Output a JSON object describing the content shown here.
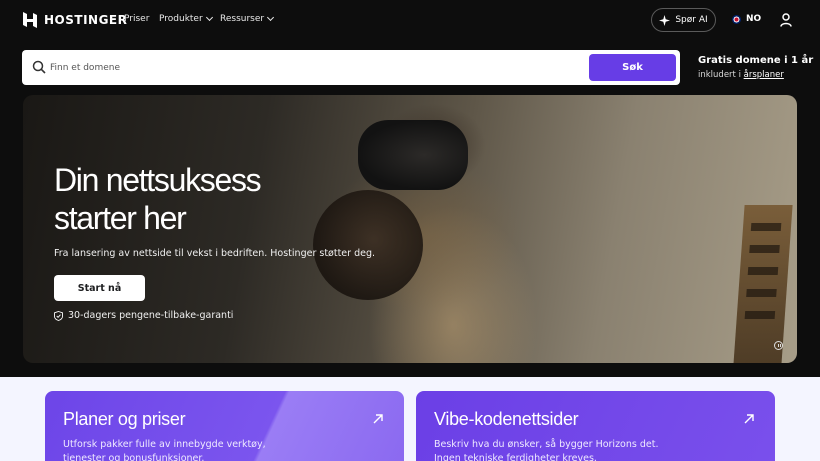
{
  "brand": {
    "name": "HOSTINGER",
    "accent": "#673de6"
  },
  "nav": {
    "links": [
      {
        "label": "Priser"
      },
      {
        "label": "Produkter",
        "dropdown": true
      },
      {
        "label": "Ressurser",
        "dropdown": true
      }
    ],
    "ai_button": "Spør AI",
    "language": "NO",
    "icons": {
      "ai": "sparkle-icon",
      "user": "user-icon"
    }
  },
  "search": {
    "placeholder": "Finn et domene",
    "value": "",
    "button": "Søk"
  },
  "promo": {
    "title": "Gratis domene i 1 år",
    "sub_prefix": "inkludert i ",
    "sub_link": "årsplaner"
  },
  "hero": {
    "title_line1": "Din nettsuksess",
    "title_line2": "starter her",
    "subtitle": "Fra lansering av nettside til vekst i bedriften. Hostinger støtter deg.",
    "cta": "Start nå",
    "guarantee": "30-dagers pengene-tilbake-garanti"
  },
  "cards": [
    {
      "title": "Planer og priser",
      "text": "Utforsk pakker fulle av innebygde verktøy, tjenester og bonusfunksjoner."
    },
    {
      "title": "Vibe-kodenettsider",
      "text": "Beskriv hva du ønsker, så bygger Horizons det. Ingen tekniske ferdigheter kreves."
    }
  ]
}
